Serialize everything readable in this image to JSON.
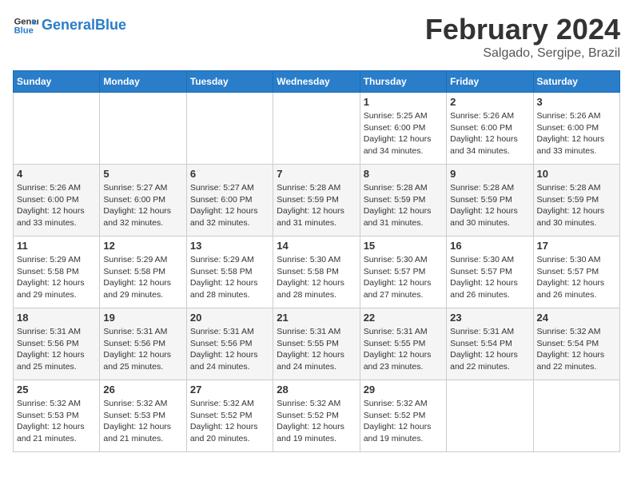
{
  "header": {
    "logo_text_part1": "General",
    "logo_text_part2": "Blue",
    "month_title": "February 2024",
    "location": "Salgado, Sergipe, Brazil"
  },
  "columns": [
    "Sunday",
    "Monday",
    "Tuesday",
    "Wednesday",
    "Thursday",
    "Friday",
    "Saturday"
  ],
  "weeks": [
    [
      {
        "num": "",
        "info": ""
      },
      {
        "num": "",
        "info": ""
      },
      {
        "num": "",
        "info": ""
      },
      {
        "num": "",
        "info": ""
      },
      {
        "num": "1",
        "info": "Sunrise: 5:25 AM\nSunset: 6:00 PM\nDaylight: 12 hours\nand 34 minutes."
      },
      {
        "num": "2",
        "info": "Sunrise: 5:26 AM\nSunset: 6:00 PM\nDaylight: 12 hours\nand 34 minutes."
      },
      {
        "num": "3",
        "info": "Sunrise: 5:26 AM\nSunset: 6:00 PM\nDaylight: 12 hours\nand 33 minutes."
      }
    ],
    [
      {
        "num": "4",
        "info": "Sunrise: 5:26 AM\nSunset: 6:00 PM\nDaylight: 12 hours\nand 33 minutes."
      },
      {
        "num": "5",
        "info": "Sunrise: 5:27 AM\nSunset: 6:00 PM\nDaylight: 12 hours\nand 32 minutes."
      },
      {
        "num": "6",
        "info": "Sunrise: 5:27 AM\nSunset: 6:00 PM\nDaylight: 12 hours\nand 32 minutes."
      },
      {
        "num": "7",
        "info": "Sunrise: 5:28 AM\nSunset: 5:59 PM\nDaylight: 12 hours\nand 31 minutes."
      },
      {
        "num": "8",
        "info": "Sunrise: 5:28 AM\nSunset: 5:59 PM\nDaylight: 12 hours\nand 31 minutes."
      },
      {
        "num": "9",
        "info": "Sunrise: 5:28 AM\nSunset: 5:59 PM\nDaylight: 12 hours\nand 30 minutes."
      },
      {
        "num": "10",
        "info": "Sunrise: 5:28 AM\nSunset: 5:59 PM\nDaylight: 12 hours\nand 30 minutes."
      }
    ],
    [
      {
        "num": "11",
        "info": "Sunrise: 5:29 AM\nSunset: 5:58 PM\nDaylight: 12 hours\nand 29 minutes."
      },
      {
        "num": "12",
        "info": "Sunrise: 5:29 AM\nSunset: 5:58 PM\nDaylight: 12 hours\nand 29 minutes."
      },
      {
        "num": "13",
        "info": "Sunrise: 5:29 AM\nSunset: 5:58 PM\nDaylight: 12 hours\nand 28 minutes."
      },
      {
        "num": "14",
        "info": "Sunrise: 5:30 AM\nSunset: 5:58 PM\nDaylight: 12 hours\nand 28 minutes."
      },
      {
        "num": "15",
        "info": "Sunrise: 5:30 AM\nSunset: 5:57 PM\nDaylight: 12 hours\nand 27 minutes."
      },
      {
        "num": "16",
        "info": "Sunrise: 5:30 AM\nSunset: 5:57 PM\nDaylight: 12 hours\nand 26 minutes."
      },
      {
        "num": "17",
        "info": "Sunrise: 5:30 AM\nSunset: 5:57 PM\nDaylight: 12 hours\nand 26 minutes."
      }
    ],
    [
      {
        "num": "18",
        "info": "Sunrise: 5:31 AM\nSunset: 5:56 PM\nDaylight: 12 hours\nand 25 minutes."
      },
      {
        "num": "19",
        "info": "Sunrise: 5:31 AM\nSunset: 5:56 PM\nDaylight: 12 hours\nand 25 minutes."
      },
      {
        "num": "20",
        "info": "Sunrise: 5:31 AM\nSunset: 5:56 PM\nDaylight: 12 hours\nand 24 minutes."
      },
      {
        "num": "21",
        "info": "Sunrise: 5:31 AM\nSunset: 5:55 PM\nDaylight: 12 hours\nand 24 minutes."
      },
      {
        "num": "22",
        "info": "Sunrise: 5:31 AM\nSunset: 5:55 PM\nDaylight: 12 hours\nand 23 minutes."
      },
      {
        "num": "23",
        "info": "Sunrise: 5:31 AM\nSunset: 5:54 PM\nDaylight: 12 hours\nand 22 minutes."
      },
      {
        "num": "24",
        "info": "Sunrise: 5:32 AM\nSunset: 5:54 PM\nDaylight: 12 hours\nand 22 minutes."
      }
    ],
    [
      {
        "num": "25",
        "info": "Sunrise: 5:32 AM\nSunset: 5:53 PM\nDaylight: 12 hours\nand 21 minutes."
      },
      {
        "num": "26",
        "info": "Sunrise: 5:32 AM\nSunset: 5:53 PM\nDaylight: 12 hours\nand 21 minutes."
      },
      {
        "num": "27",
        "info": "Sunrise: 5:32 AM\nSunset: 5:52 PM\nDaylight: 12 hours\nand 20 minutes."
      },
      {
        "num": "28",
        "info": "Sunrise: 5:32 AM\nSunset: 5:52 PM\nDaylight: 12 hours\nand 19 minutes."
      },
      {
        "num": "29",
        "info": "Sunrise: 5:32 AM\nSunset: 5:52 PM\nDaylight: 12 hours\nand 19 minutes."
      },
      {
        "num": "",
        "info": ""
      },
      {
        "num": "",
        "info": ""
      }
    ]
  ]
}
